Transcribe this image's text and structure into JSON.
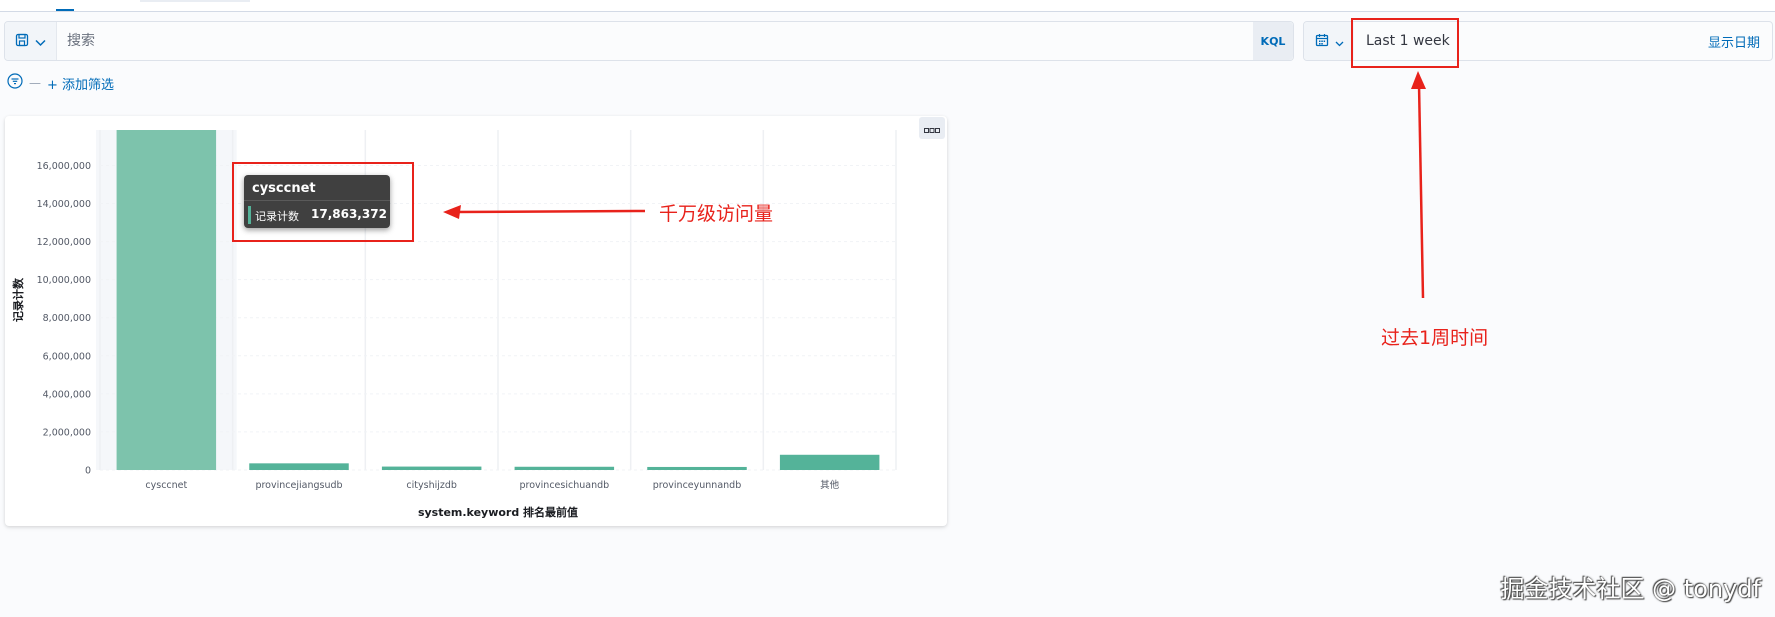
{
  "query": {
    "placeholder": "搜索",
    "language": "KQL"
  },
  "date": {
    "quick_range": "Last 1 week",
    "show_dates": "显示日期"
  },
  "filter": {
    "add_label": "+ 添加筛选"
  },
  "tooltip": {
    "title": "cysccnet",
    "label": "记录计数",
    "value": "17,863,372"
  },
  "annotations": {
    "tooltip_note": "千万级访问量",
    "time_note": "过去1周时间"
  },
  "watermark": "掘金技术社区 @ tonydf",
  "colors": {
    "bar": "#54b399",
    "annotation": "#e8221b",
    "accent": "#006bb8"
  },
  "chart_data": {
    "type": "bar",
    "categories": [
      "cysccnet",
      "provincejiangsudb",
      "cityshijzdb",
      "provincesichuandb",
      "provinceyunnandb",
      "其他"
    ],
    "values": [
      17863372,
      350000,
      180000,
      170000,
      160000,
      800000
    ],
    "xlabel": "system.keyword 排名最前值",
    "ylabel": "记录计数",
    "yticks": [
      "0",
      "2,000,000",
      "4,000,000",
      "6,000,000",
      "8,000,000",
      "10,000,000",
      "12,000,000",
      "14,000,000",
      "16,000,000"
    ],
    "ylim": [
      0,
      17863372
    ],
    "highlighted_category": "cysccnet",
    "grid": true,
    "legend": "none"
  }
}
